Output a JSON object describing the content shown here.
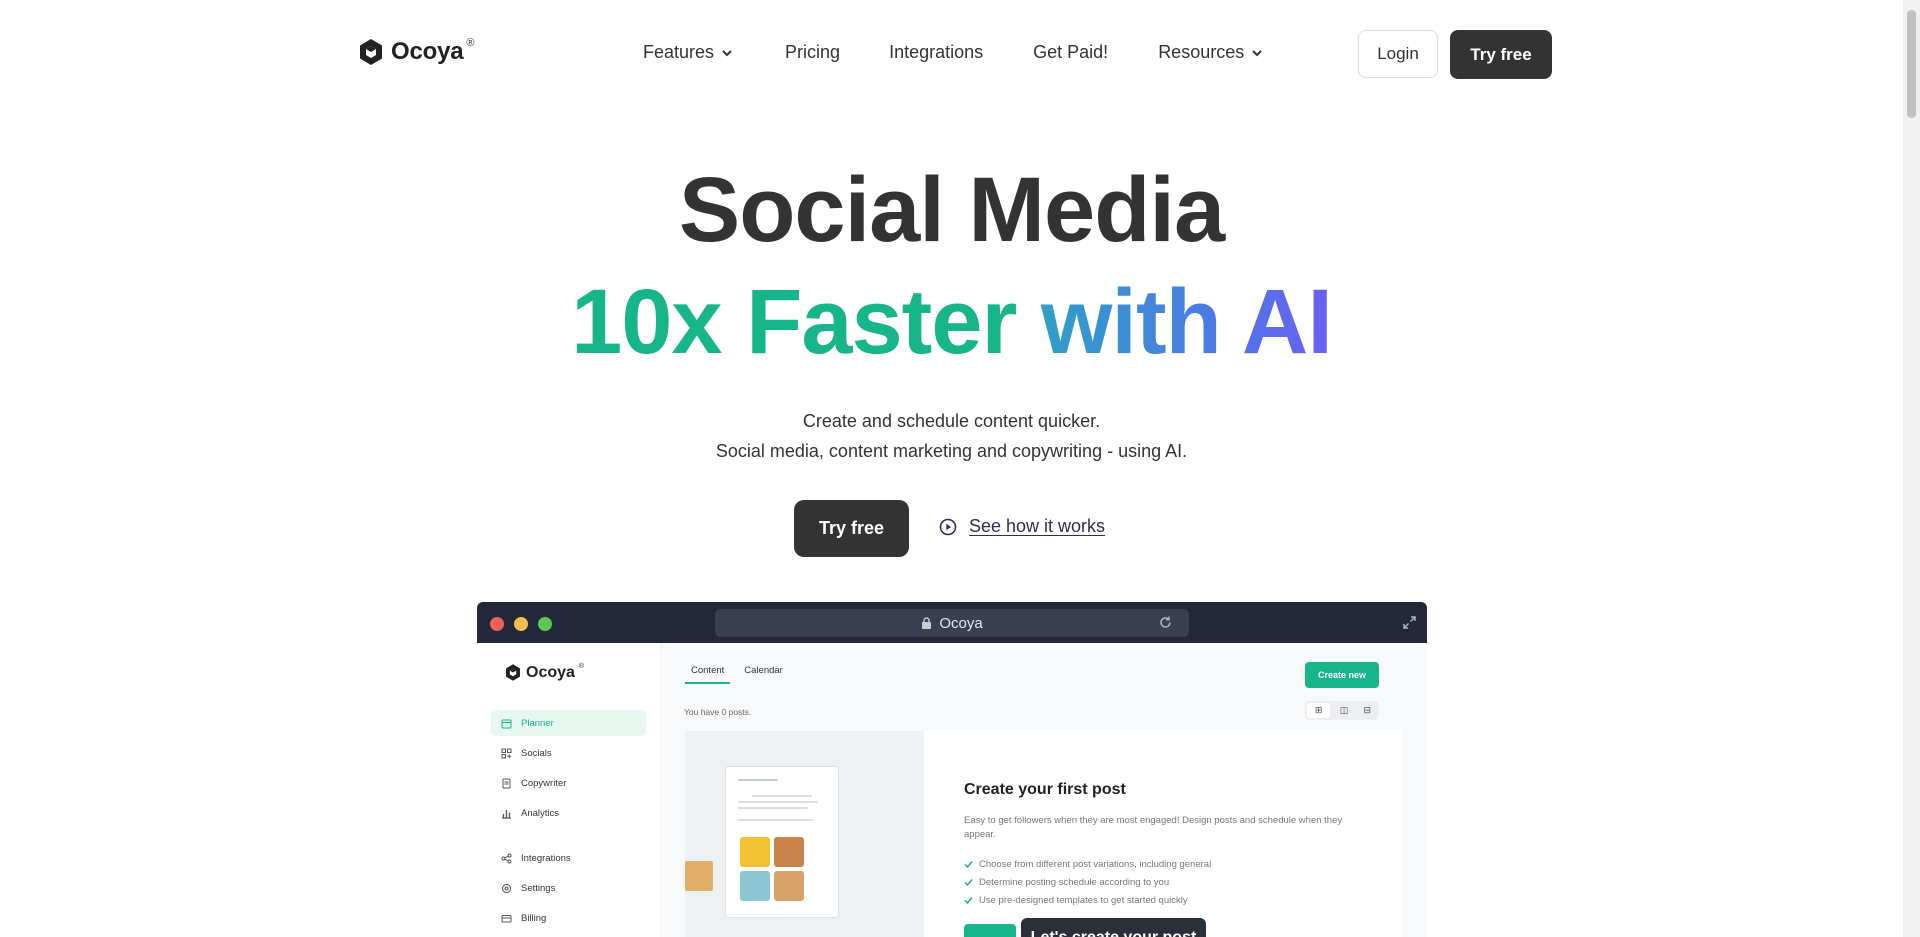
{
  "nav": {
    "brand": "Ocoya",
    "brand_mark": "®",
    "items": [
      {
        "label": "Features",
        "has_dropdown": true
      },
      {
        "label": "Pricing",
        "has_dropdown": false
      },
      {
        "label": "Integrations",
        "has_dropdown": false
      },
      {
        "label": "Get Paid!",
        "has_dropdown": false
      },
      {
        "label": "Resources",
        "has_dropdown": true
      }
    ],
    "login_label": "Login",
    "try_label": "Try free"
  },
  "hero": {
    "title_line1": "Social Media",
    "title_line2_green": "10x Faster",
    "title_line2_blue": "with AI",
    "subtitle_line1": "Create and schedule content quicker.",
    "subtitle_line2": "Social media, content marketing and copywriting - using AI.",
    "cta_label": "Try free",
    "watch_label": "See how it works"
  },
  "preview": {
    "url_title": "Ocoya",
    "sidebar": {
      "brand": "Ocoya",
      "brand_mark": "®",
      "items": [
        {
          "label": "Planner",
          "icon": "calendar-icon",
          "active": true
        },
        {
          "label": "Socials",
          "icon": "grid-icon",
          "active": false
        },
        {
          "label": "Copywriter",
          "icon": "document-icon",
          "active": false
        },
        {
          "label": "Analytics",
          "icon": "bar-chart-icon",
          "active": false
        },
        {
          "label": "Integrations",
          "icon": "share-icon",
          "active": false
        },
        {
          "label": "Settings",
          "icon": "gear-icon",
          "active": false
        },
        {
          "label": "Billing",
          "icon": "card-icon",
          "active": false
        }
      ]
    },
    "tabs": [
      "Content",
      "Calendar"
    ],
    "create_new_label": "Create new",
    "posts_count": "You have 0 posts.",
    "card": {
      "title": "Create your first post",
      "description": "Easy to get followers when they are most engaged! Design posts and schedule when they appear.",
      "checks": [
        "Choose from different post variations, including general",
        "Determine posting schedule according to you",
        "Use pre-designed templates to get started quickly"
      ],
      "tooltip": "Let's create your post"
    }
  },
  "colors": {
    "accent_green": "#17b58a",
    "accent_blue": "#4d78e6",
    "dark_button": "#333333",
    "window_chrome": "#232838"
  }
}
